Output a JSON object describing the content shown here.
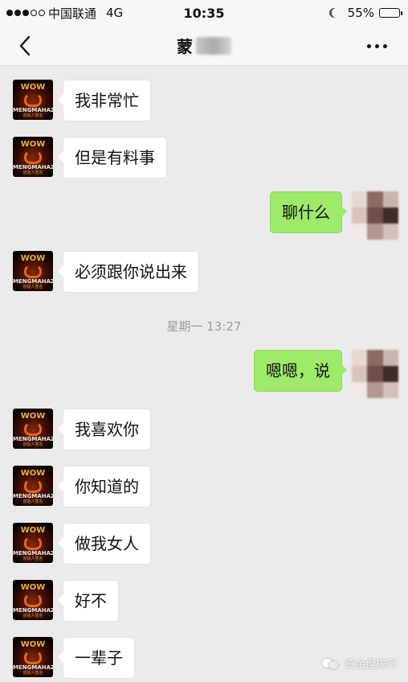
{
  "status_bar": {
    "carrier": "中国联通",
    "network": "4G",
    "time": "10:35",
    "battery": "55%",
    "battery_level": 0.55
  },
  "header": {
    "title": "蒙"
  },
  "messages": [
    {
      "side": "left",
      "text": "我非常忙"
    },
    {
      "side": "left",
      "text": "但是有料事"
    },
    {
      "side": "right",
      "text": "聊什么"
    },
    {
      "side": "left",
      "text": "必须跟你说出来"
    },
    {
      "side": "right",
      "text": "嗯嗯，说"
    },
    {
      "side": "left",
      "text": "我喜欢你"
    },
    {
      "side": "left",
      "text": "你知道的"
    },
    {
      "side": "left",
      "text": "做我女人"
    },
    {
      "side": "left",
      "text": "好不"
    },
    {
      "side": "left",
      "text": "一辈子"
    }
  ],
  "timestamp": "星期一 13:27",
  "avatar_text": {
    "crown": "WOW",
    "brand": "MENGMAHAZU",
    "sub": "创始人签名"
  },
  "watermark": "资金盘排行",
  "colors": {
    "background": "#ebebeb",
    "my_bubble": "#9eea6a",
    "their_bubble": "#ffffff",
    "timestamp_text": "#9b9b9b"
  },
  "icons": {
    "back": "chevron-left-icon",
    "more": "more-dots-icon",
    "dnd": "moon-icon",
    "battery": "battery-icon",
    "watermark": "wechat-official-account-icon"
  }
}
